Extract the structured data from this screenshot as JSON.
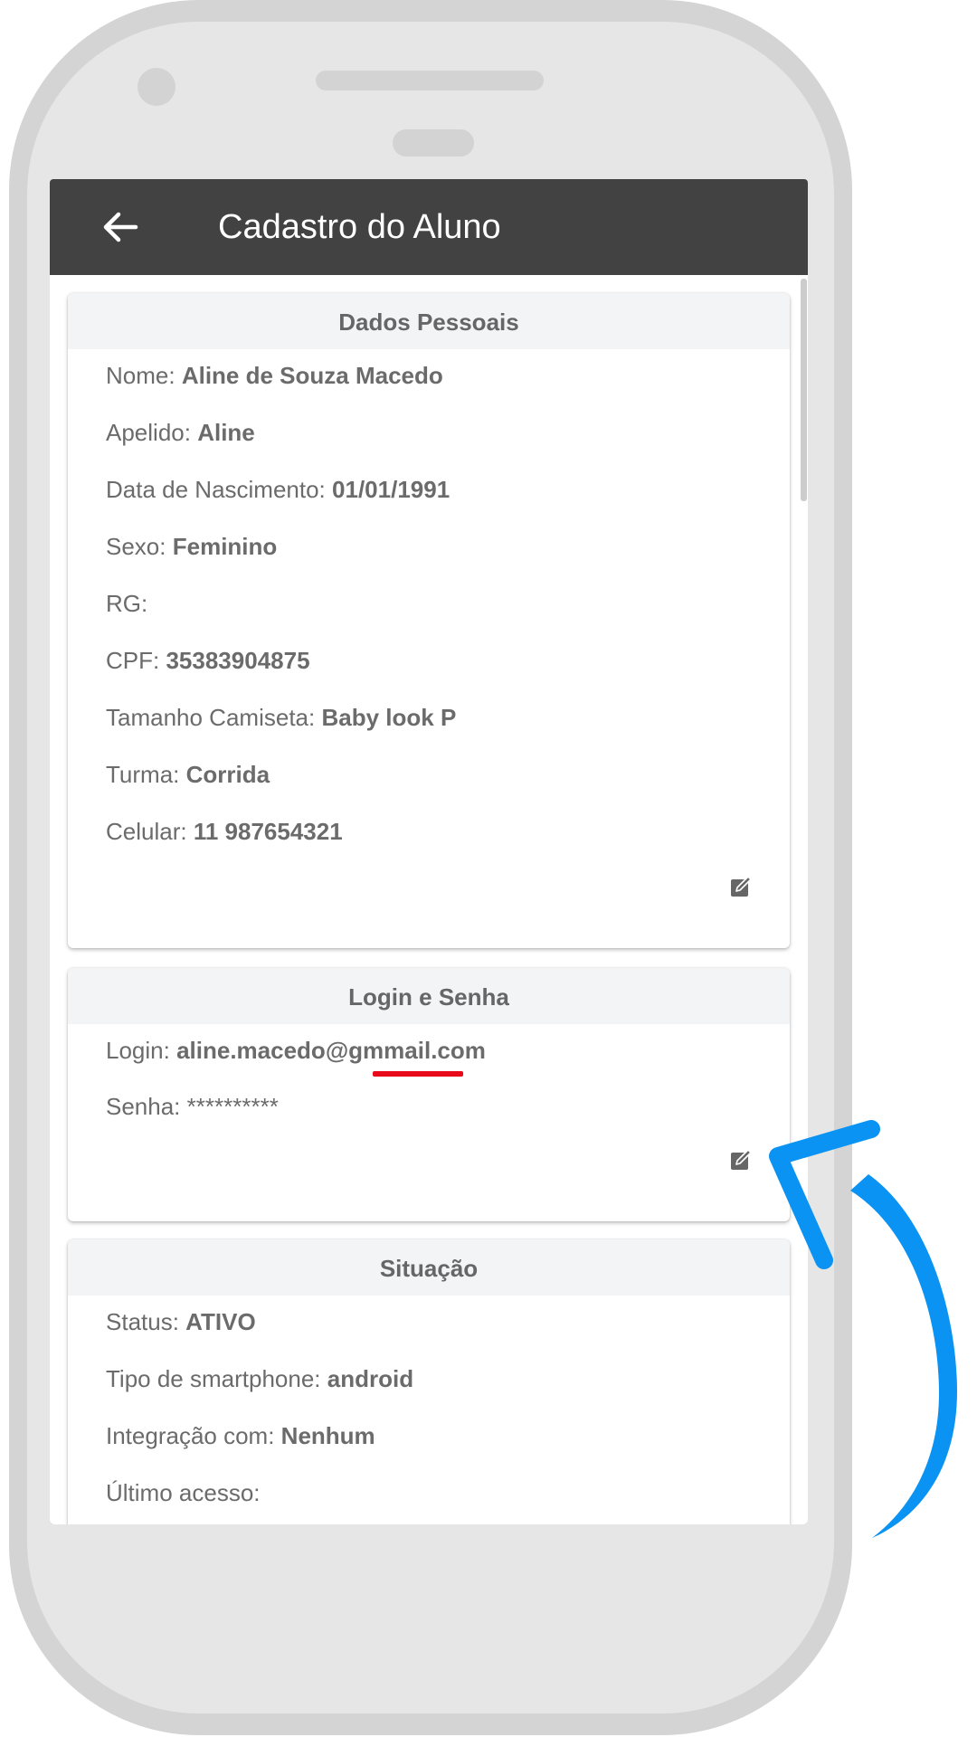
{
  "app_bar": {
    "title": "Cadastro do Aluno",
    "back_icon": "arrow-left-icon"
  },
  "cards": {
    "personal": {
      "title": "Dados Pessoais",
      "fields": [
        {
          "label": "Nome:",
          "value": "Aline de Souza Macedo"
        },
        {
          "label": "Apelido:",
          "value": "Aline"
        },
        {
          "label": "Data de Nascimento:",
          "value": "01/01/1991"
        },
        {
          "label": "Sexo:",
          "value": "Feminino"
        },
        {
          "label": "RG:",
          "value": ""
        },
        {
          "label": "CPF:",
          "value": "35383904875"
        },
        {
          "label": "Tamanho Camiseta:",
          "value": "Baby look P"
        },
        {
          "label": "Turma:",
          "value": "Corrida"
        },
        {
          "label": "Celular:",
          "value": "11 987654321"
        }
      ],
      "edit_icon": "edit-icon"
    },
    "login": {
      "title": "Login e Senha",
      "login_label": "Login:",
      "login_prefix": "aline.macedo@",
      "login_domain": "gmmail",
      "login_suffix": ".com",
      "password_label": "Senha:",
      "password_value": "**********",
      "edit_icon": "edit-icon"
    },
    "status": {
      "title": "Situação",
      "fields": [
        {
          "label": "Status:",
          "value": "ATIVO"
        },
        {
          "label": "Tipo de smartphone:",
          "value": "android"
        },
        {
          "label": "Integração com:",
          "value": "Nenhum"
        },
        {
          "label": "Último acesso:",
          "value": ""
        }
      ]
    }
  },
  "colors": {
    "app_bar": "#424242",
    "card_header": "#f3f4f6",
    "text": "#6b6b6b",
    "annotation_underline": "#e8091b",
    "annotation_arrow": "#0a93f2"
  }
}
